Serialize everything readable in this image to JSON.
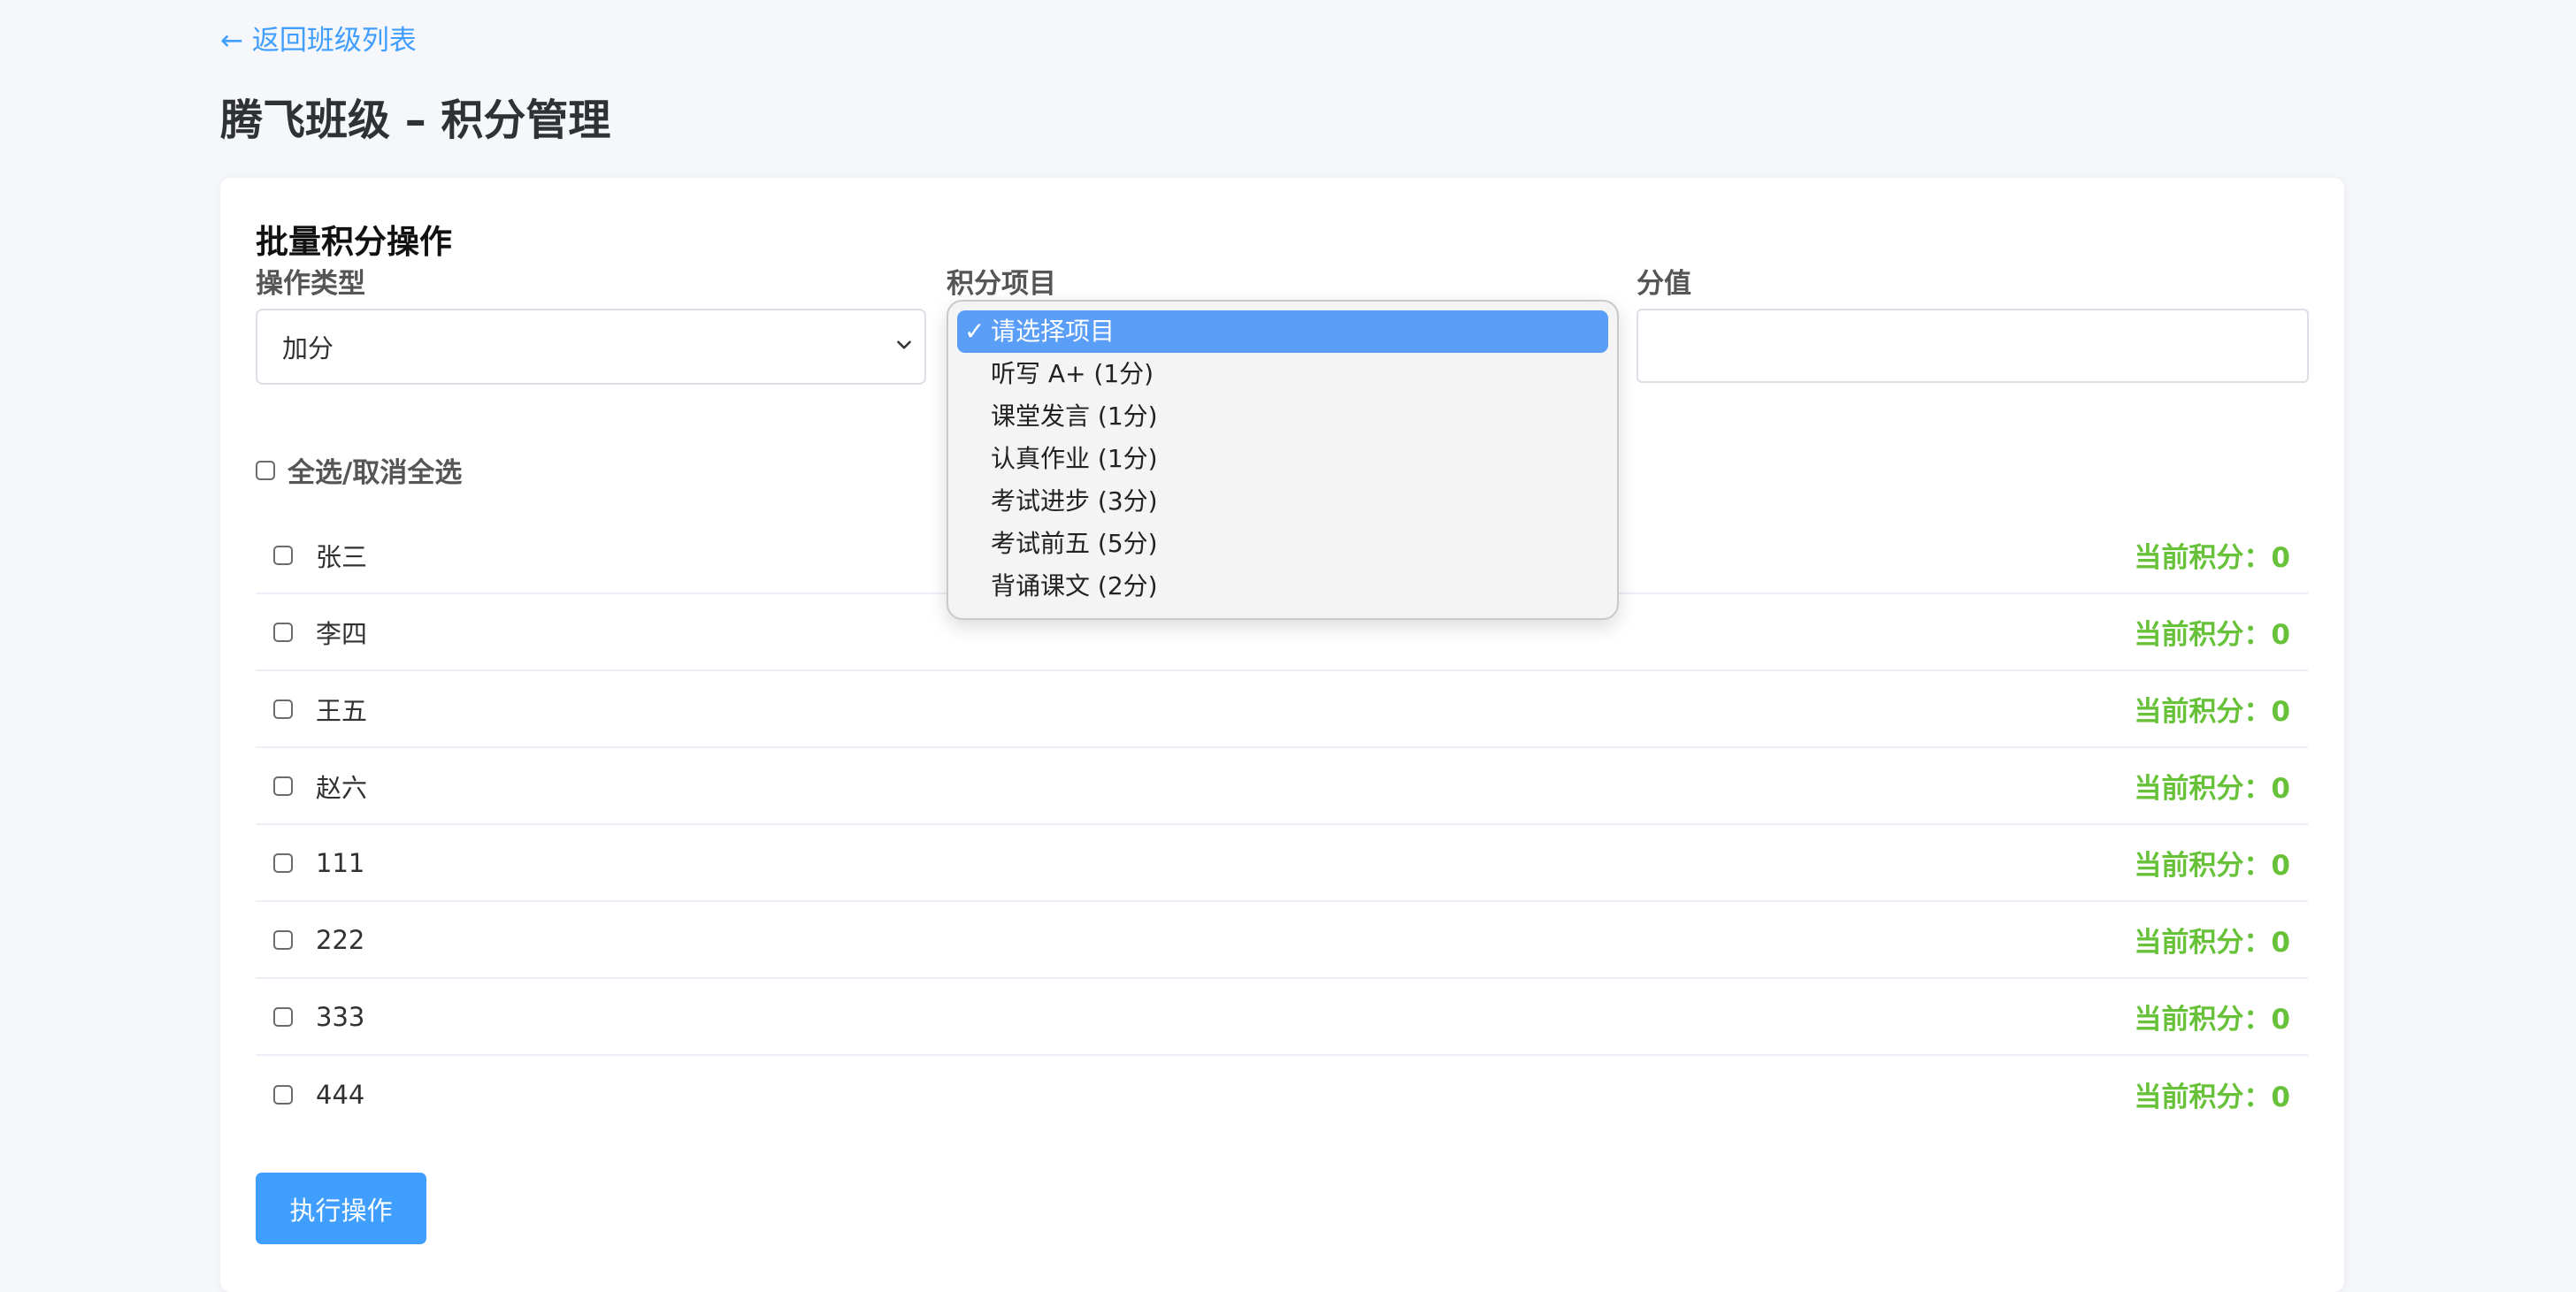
{
  "nav": {
    "back_label": "← 返回班级列表"
  },
  "page": {
    "title": "腾飞班级 – 积分管理"
  },
  "batch": {
    "section_title": "批量积分操作",
    "op_type": {
      "label": "操作类型",
      "value": "加分"
    },
    "item": {
      "label": "积分项目",
      "options": [
        {
          "label": "请选择项目",
          "selected": true
        },
        {
          "label": "听写 A+ (1分)",
          "selected": false
        },
        {
          "label": "课堂发言 (1分)",
          "selected": false
        },
        {
          "label": "认真作业 (1分)",
          "selected": false
        },
        {
          "label": "考试进步 (3分)",
          "selected": false
        },
        {
          "label": "考试前五 (5分)",
          "selected": false
        },
        {
          "label": "背诵课文 (2分)",
          "selected": false
        }
      ]
    },
    "value": {
      "label": "分值",
      "value": "",
      "placeholder": ""
    },
    "select_all_label": "全选/取消全选",
    "students": [
      {
        "name": "张三",
        "score": "当前积分：0"
      },
      {
        "name": "李四",
        "score": "当前积分：0"
      },
      {
        "name": "王五",
        "score": "当前积分：0"
      },
      {
        "name": "赵六",
        "score": "当前积分：0"
      },
      {
        "name": "111",
        "score": "当前积分：0"
      },
      {
        "name": "222",
        "score": "当前积分：0"
      },
      {
        "name": "333",
        "score": "当前积分：0"
      },
      {
        "name": "444",
        "score": "当前积分：0"
      }
    ],
    "execute_label": "执行操作"
  },
  "colors": {
    "accent": "#409eff",
    "score_green": "#67c23a",
    "dropdown_selected": "#5a9ef8"
  },
  "icons": {
    "back": "arrow-left-icon",
    "select_chevron": "chevron-down-icon",
    "selected_check": "check-icon"
  }
}
